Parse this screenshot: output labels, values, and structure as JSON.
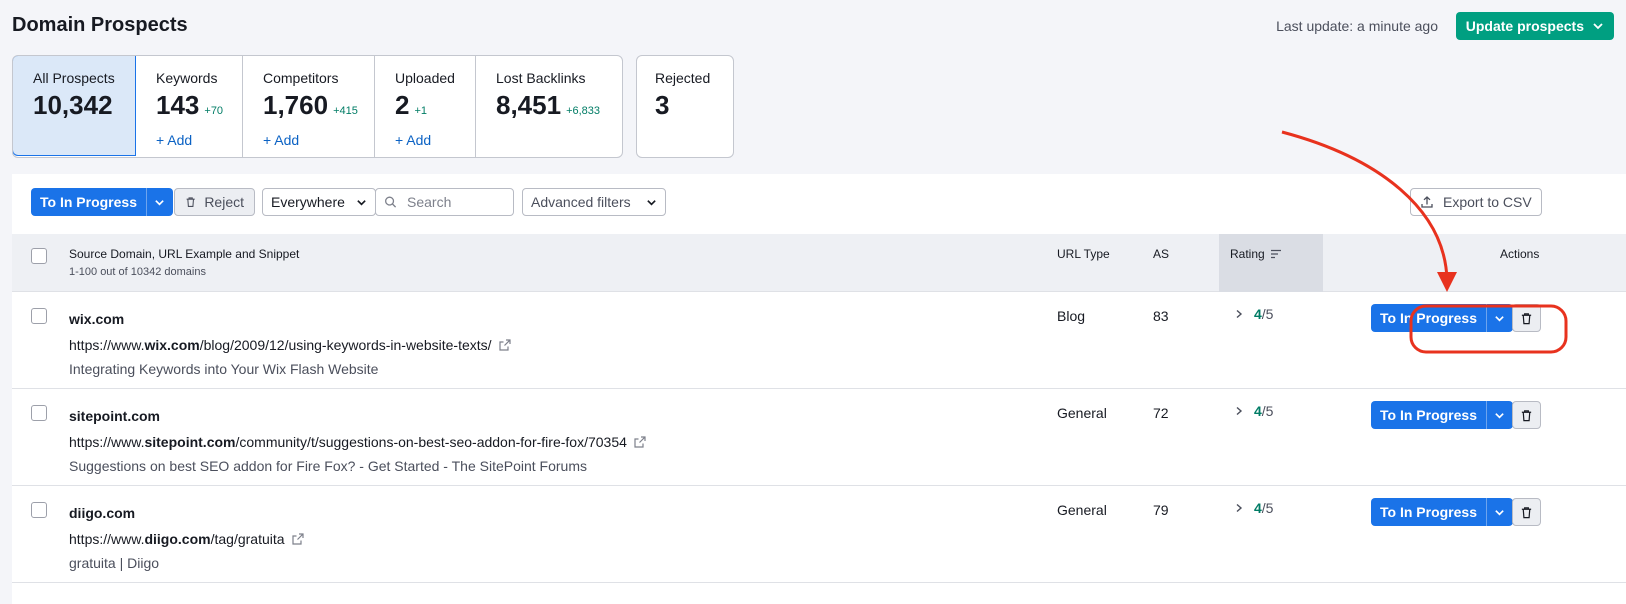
{
  "header": {
    "title": "Domain Prospects",
    "last_update": "Last update: a minute ago",
    "update_button": "Update prospects"
  },
  "tabs": [
    {
      "label": "All Prospects",
      "count": "10,342",
      "delta": "",
      "add": ""
    },
    {
      "label": "Keywords",
      "count": "143",
      "delta": "+70",
      "add": "+ Add"
    },
    {
      "label": "Competitors",
      "count": "1,760",
      "delta": "+415",
      "add": "+ Add"
    },
    {
      "label": "Uploaded",
      "count": "2",
      "delta": "+1",
      "add": "+ Add"
    },
    {
      "label": "Lost Backlinks",
      "count": "8,451",
      "delta": "+6,833",
      "add": ""
    }
  ],
  "rejected_tab": {
    "label": "Rejected",
    "count": "3"
  },
  "toolbar": {
    "to_in_progress": "To In Progress",
    "reject": "Reject",
    "scope_select": "Everywhere",
    "search_placeholder": "Search",
    "advanced_filters": "Advanced filters",
    "export": "Export to CSV"
  },
  "table": {
    "columns": {
      "source": "Source Domain, URL Example and Snippet",
      "source_sub": "1-100 out of 10342 domains",
      "url_type": "URL Type",
      "as": "AS",
      "rating": "Rating",
      "actions": "Actions"
    },
    "rows": [
      {
        "domain": "wix.com",
        "url_prefix": "https://www.",
        "url_domain": "wix.com",
        "url_path": "/blog/2009/12/using-keywords-in-website-texts/",
        "snippet": "Integrating Keywords into Your Wix Flash Website",
        "url_type": "Blog",
        "as": "83",
        "rating": "4",
        "rating_of": "/5",
        "action": "To In Progress"
      },
      {
        "domain": "sitepoint.com",
        "url_prefix": "https://www.",
        "url_domain": "sitepoint.com",
        "url_path": "/community/t/suggestions-on-best-seo-addon-for-fire-fox/70354",
        "snippet": "Suggestions on best SEO addon for Fire Fox? - Get Started - The SitePoint Forums",
        "url_type": "General",
        "as": "72",
        "rating": "4",
        "rating_of": "/5",
        "action": "To In Progress"
      },
      {
        "domain": "diigo.com",
        "url_prefix": "https://www.",
        "url_domain": "diigo.com",
        "url_path": "/tag/gratuita",
        "snippet": "gratuita | Diigo",
        "url_type": "General",
        "as": "79",
        "rating": "4",
        "rating_of": "/5",
        "action": "To In Progress"
      }
    ]
  },
  "colors": {
    "primary": "#1a73e8",
    "success": "#009f81",
    "annotation": "#e8321e"
  }
}
